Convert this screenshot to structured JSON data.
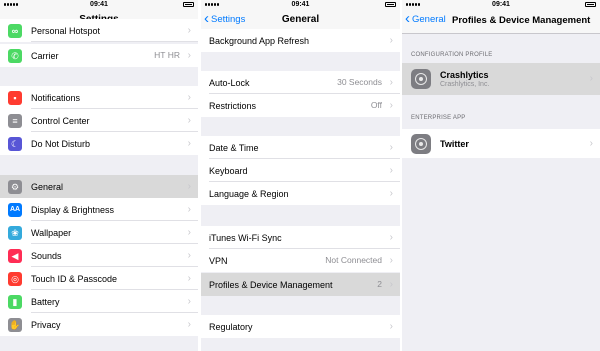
{
  "status": {
    "time": "09:41"
  },
  "settings": {
    "title": "Settings",
    "carrier_detail": "HT HR",
    "partial_top_label": "Personal Hotspot",
    "items": [
      {
        "label": "Carrier",
        "icon": "phone-icon",
        "color": "#4cd964"
      },
      {
        "label": "Notifications",
        "icon": "notifications-icon",
        "color": "#ff3b30"
      },
      {
        "label": "Control Center",
        "icon": "control-center-icon",
        "color": "#8e8e93"
      },
      {
        "label": "Do Not Disturb",
        "icon": "moon-icon",
        "color": "#5856d6"
      },
      {
        "label": "General",
        "icon": "gear-icon",
        "color": "#8e8e93"
      },
      {
        "label": "Display & Brightness",
        "icon": "display-icon",
        "color": "#007aff"
      },
      {
        "label": "Wallpaper",
        "icon": "wallpaper-icon",
        "color": "#34aadc"
      },
      {
        "label": "Sounds",
        "icon": "speaker-icon",
        "color": "#ff2d55"
      },
      {
        "label": "Touch ID & Passcode",
        "icon": "fingerprint-icon",
        "color": "#ff3b30"
      },
      {
        "label": "Battery",
        "icon": "battery-icon",
        "color": "#4cd964"
      },
      {
        "label": "Privacy",
        "icon": "hand-icon",
        "color": "#8e8e93"
      }
    ]
  },
  "general": {
    "back_label": "Settings",
    "title": "General",
    "items": [
      {
        "label": "Background App Refresh"
      },
      {
        "label": "Auto-Lock",
        "detail": "30 Seconds"
      },
      {
        "label": "Restrictions",
        "detail": "Off"
      },
      {
        "label": "Date & Time"
      },
      {
        "label": "Keyboard"
      },
      {
        "label": "Language & Region"
      },
      {
        "label": "iTunes Wi-Fi Sync"
      },
      {
        "label": "VPN",
        "detail": "Not Connected"
      },
      {
        "label": "Profiles & Device Management",
        "detail": "2"
      },
      {
        "label": "Regulatory"
      }
    ]
  },
  "profiles": {
    "back_label": "General",
    "title": "Profiles & Device Management",
    "config_header": "CONFIGURATION PROFILE",
    "config_name": "Crashlytics",
    "config_org": "Crashlytics, Inc.",
    "enterprise_header": "ENTERPRISE APP",
    "enterprise_name": "Twitter"
  }
}
